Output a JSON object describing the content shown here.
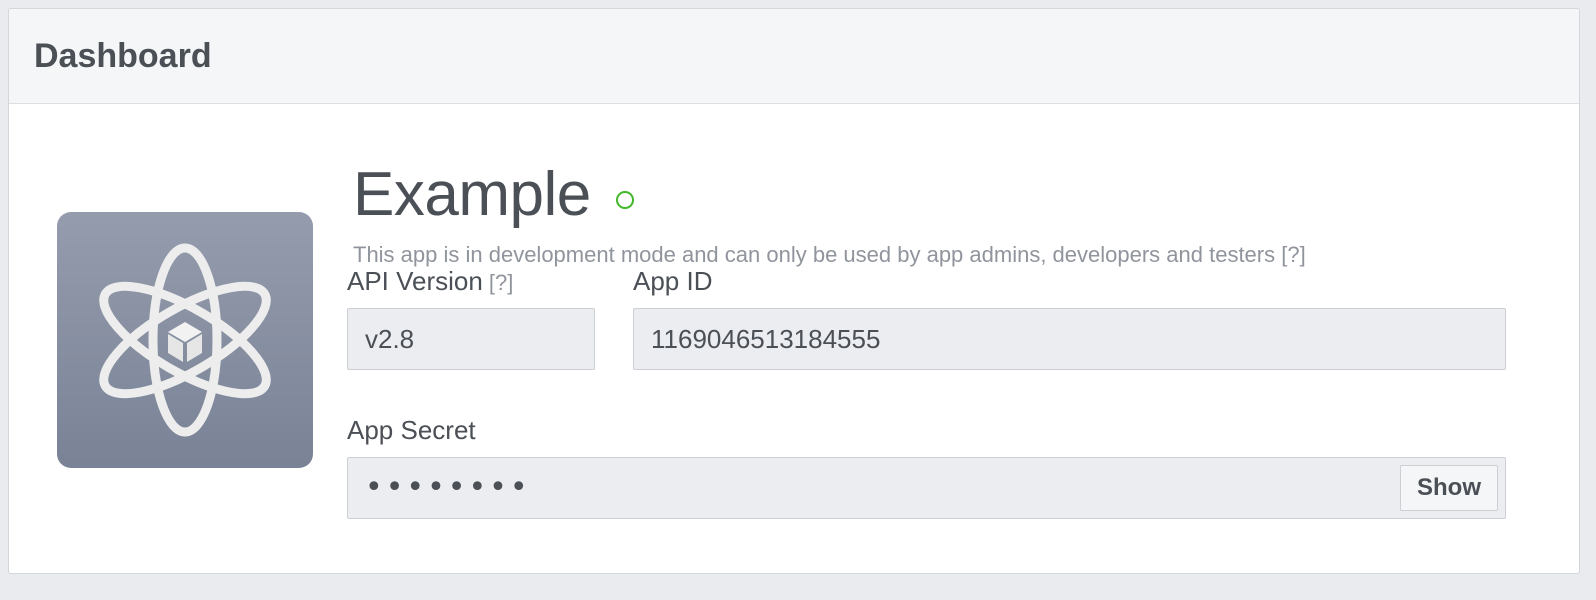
{
  "header": {
    "title": "Dashboard"
  },
  "app": {
    "icon": "atom-cube-icon",
    "name": "Example",
    "status_color": "#42b72a",
    "dev_mode_note": "This app is in development mode and can only be used by app admins, developers and testers",
    "help_marker": "[?]"
  },
  "fields": {
    "api_version": {
      "label": "API Version",
      "help_marker": "[?]",
      "value": "v2.8"
    },
    "app_id": {
      "label": "App ID",
      "value": "1169046513184555"
    },
    "app_secret": {
      "label": "App Secret",
      "value": "••••••••",
      "show_label": "Show"
    }
  },
  "colors": {
    "page_background": "#e9ebee",
    "header_background": "#f5f6f7",
    "field_background": "#ebedf0",
    "text": "#4b4f56",
    "muted_text": "#90949c"
  }
}
